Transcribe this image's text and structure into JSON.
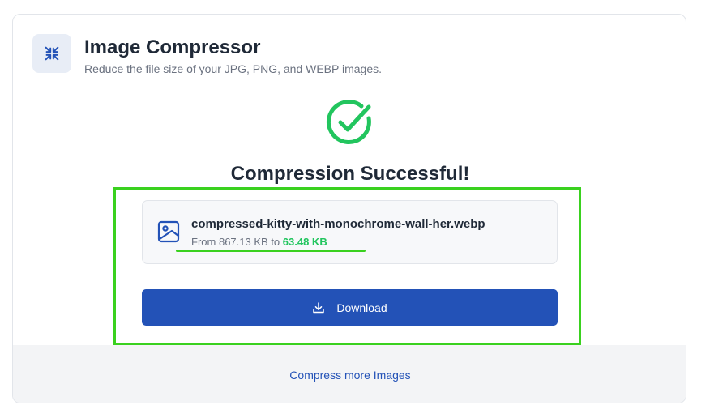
{
  "app": {
    "title": "Image Compressor",
    "subtitle": "Reduce the file size of your JPG, PNG, and WEBP images.",
    "icon": "compress-arrows-icon"
  },
  "result": {
    "status_icon": "check-circle-icon",
    "title": "Compression Successful!",
    "file_icon": "image-file-icon",
    "file_name": "compressed-kitty-with-monochrome-wall-her.webp",
    "from_prefix": "From",
    "original_size": "867.13 KB",
    "to_word": "to",
    "compressed_size": "63.48 KB"
  },
  "actions": {
    "download_label": "Download",
    "download_icon": "download-icon",
    "more_label": "Compress more Images"
  },
  "colors": {
    "accent": "#2352b7",
    "success": "#22c55e",
    "highlight": "#3ad11f"
  }
}
